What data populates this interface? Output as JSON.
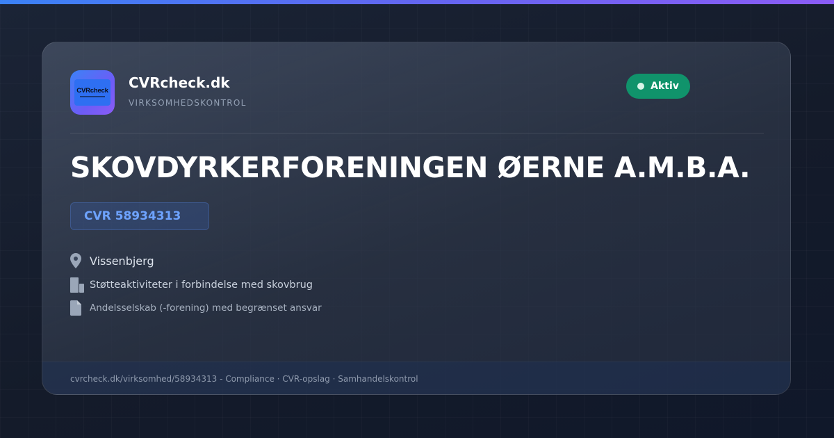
{
  "brand": {
    "logo_text": "CVRcheck",
    "name": "CVRcheck.dk",
    "tagline": "VIRKSOMHEDSKONTROL"
  },
  "status": {
    "label": "Aktiv",
    "color": "#10936b"
  },
  "company": {
    "name": "SKOVDYRKERFORENINGEN ØERNE A.M.B.A.",
    "cvr": "CVR 58934313",
    "city": "Vissenbjerg",
    "industry": "Støtteaktiviteter i forbindelse med skovbrug",
    "legal_form": "Andelsselskab (-forening) med begrænset ansvar"
  },
  "icons": {
    "location": "map-pin-icon",
    "industry": "building-icon",
    "legal_form": "document-icon"
  },
  "footer": {
    "text": "cvrcheck.dk/virksomhed/58934313 - Compliance · CVR-opslag · Samhandelskontrol"
  },
  "colors": {
    "accent_gradient_start": "#3b82f6",
    "accent_gradient_end": "#8b5cf6",
    "cvr_text": "#6ea3ff",
    "background": "#141c2c"
  }
}
